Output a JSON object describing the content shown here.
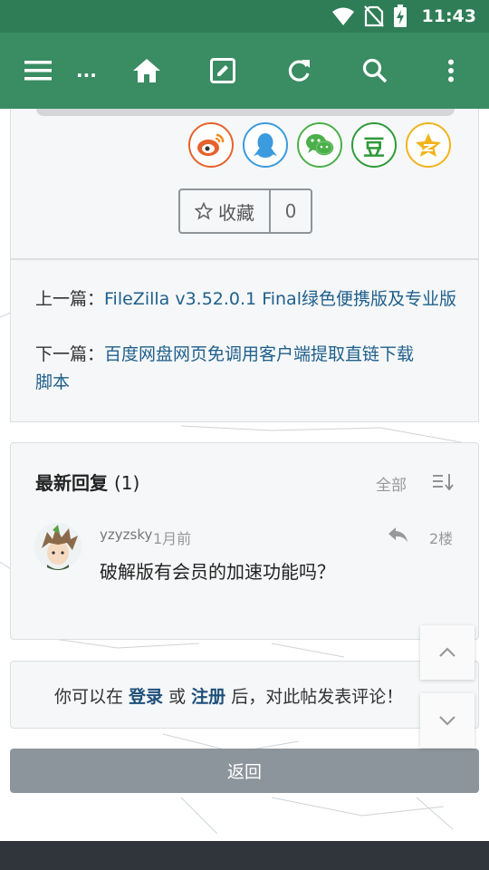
{
  "status": {
    "time": "11:43"
  },
  "toolbar": {
    "title": "...",
    "icons": [
      "menu-icon",
      "home-icon",
      "edit-icon",
      "refresh-icon",
      "search-icon",
      "more-vert-icon"
    ]
  },
  "share": {
    "icons": [
      "weibo-icon",
      "qq-icon",
      "wechat-icon",
      "douban-icon",
      "qzone-icon"
    ],
    "douban_char": "豆",
    "colors": {
      "weibo": "#e6622c",
      "qq": "#3c9bde",
      "wechat": "#4cb04a",
      "douban": "#2f9a3a",
      "qzone": "#f2b31d"
    }
  },
  "favorite": {
    "label": "收藏",
    "count": "0"
  },
  "navigation": {
    "prev_label": "上一篇：",
    "prev_title": "FileZilla v3.52.0.1 Final绿色便携版及专业版",
    "next_label": "下一篇：",
    "next_title_line1": "百度网盘网页免调用客户端提取直链下载",
    "next_title_line2": "脚本"
  },
  "replies": {
    "title": "最新回复",
    "count": "(1)",
    "all_label": "全部",
    "items": [
      {
        "user": "yzyzsky",
        "time": "1月前",
        "floor": "2楼",
        "text": "破解版有会员的加速功能吗？"
      }
    ]
  },
  "login_prompt": {
    "prefix": "你可以在 ",
    "login": "登录",
    "or": " 或 ",
    "register": "注册",
    "suffix": " 后，对此帖发表评论！"
  },
  "back_button": "返回",
  "colors": {
    "toolbar": "#3a8c63",
    "status_bar": "#2e7d57",
    "link": "#1f5f8b"
  }
}
